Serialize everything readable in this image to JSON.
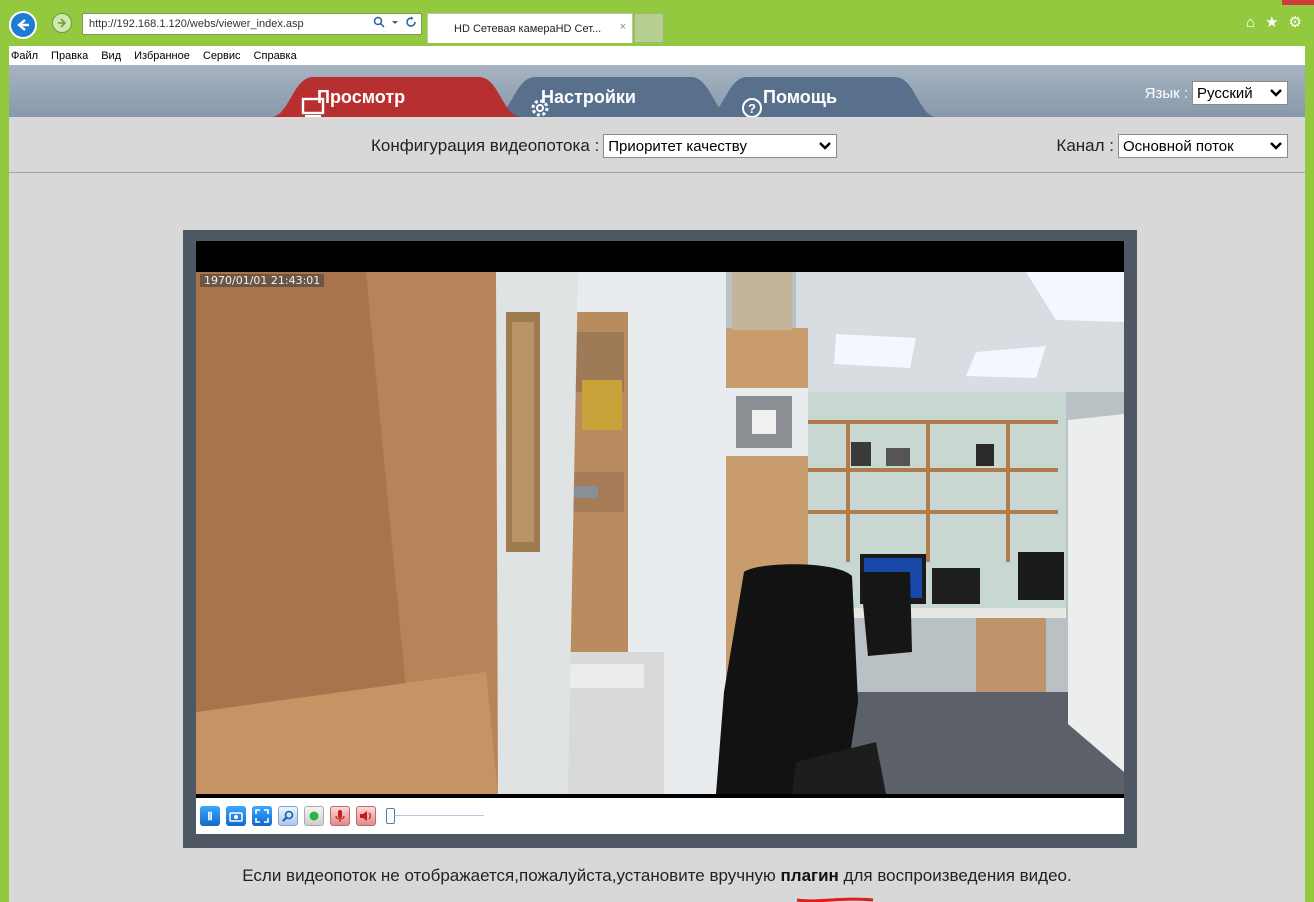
{
  "browser": {
    "url": "http://192.168.1.120/webs/viewer_index.asp",
    "tab_title": "HD Сетевая камераHD Сет...",
    "tab_close": "×",
    "menu": [
      "Файл",
      "Правка",
      "Вид",
      "Избранное",
      "Сервис",
      "Справка"
    ]
  },
  "nav": {
    "tabs": [
      {
        "label": "Просмотр",
        "icon": "monitor-icon",
        "active": true
      },
      {
        "label": "Настройки",
        "icon": "gear-icon",
        "active": false
      },
      {
        "label": "Помощь",
        "icon": "help-icon",
        "active": false
      }
    ],
    "language_label": "Язык :",
    "language_value": "Русский"
  },
  "stream": {
    "config_label": "Конфигурация видеопотока :",
    "config_value": "Приоритет качеству",
    "channel_label": "Канал :",
    "channel_value": "Основной поток"
  },
  "video": {
    "timestamp": "1970/01/01 21:43:01",
    "controls": [
      "pause-icon",
      "snapshot-icon",
      "fullscreen-icon",
      "zoom-icon",
      "record-icon",
      "microphone-icon",
      "speaker-icon"
    ],
    "volume": 0
  },
  "hint": {
    "before": "Если видеопоток не отображается,пожалуйста,установите вручную ",
    "link": "плагин",
    "after": " для воспроизведения видео."
  },
  "colors": {
    "browser_frame": "#93c93f",
    "active_tab": "#b82f30",
    "inactive_tab": "#58708c",
    "header": "#96a6b7"
  }
}
